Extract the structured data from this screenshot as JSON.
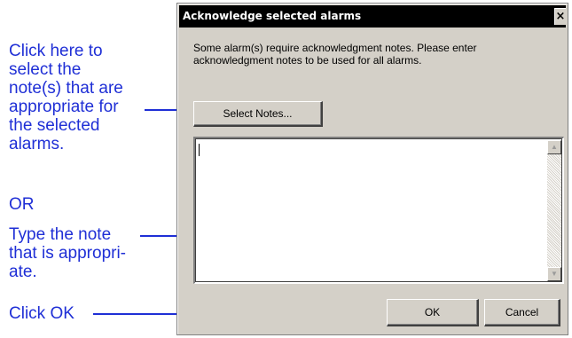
{
  "annotations": {
    "select_notes_callout": [
      "Click here to",
      "select the",
      "note(s) that are",
      "appropriate for",
      "the selected",
      "alarms."
    ],
    "or_text": "OR",
    "type_note_callout": [
      "Type the note",
      "that is appropri-",
      "ate."
    ],
    "click_ok_callout": "Click OK",
    "color": "#1f2fd6"
  },
  "dialog": {
    "title": "Acknowledge selected alarms",
    "close_glyph": "×",
    "message": "Some alarm(s) require acknowledgment notes. Please enter acknowledgment notes to be used for all alarms.",
    "select_notes_label": "Select Notes...",
    "notes_value": "",
    "ok_label": "OK",
    "cancel_label": "Cancel"
  }
}
